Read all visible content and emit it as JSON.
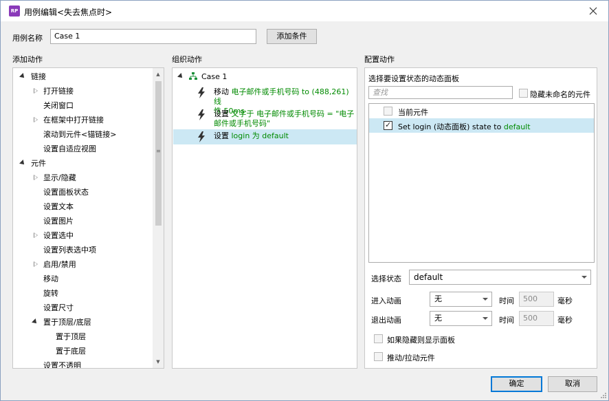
{
  "window": {
    "title": "用例编辑<失去焦点时>",
    "app_icon_text": "RP"
  },
  "case_name": {
    "label": "用例名称",
    "value": "Case 1",
    "add_condition_label": "添加条件"
  },
  "add_actions": {
    "heading": "添加动作",
    "items": [
      {
        "label": "链接",
        "level": 0,
        "state": "open"
      },
      {
        "label": "打开链接",
        "level": 1,
        "state": "closed"
      },
      {
        "label": "关闭窗口",
        "level": 1,
        "state": "none"
      },
      {
        "label": "在框架中打开链接",
        "level": 1,
        "state": "closed"
      },
      {
        "label": "滚动到元件<锚链接>",
        "level": 1,
        "state": "none"
      },
      {
        "label": "设置自适应视图",
        "level": 1,
        "state": "none"
      },
      {
        "label": "元件",
        "level": 0,
        "state": "open"
      },
      {
        "label": "显示/隐藏",
        "level": 1,
        "state": "closed"
      },
      {
        "label": "设置面板状态",
        "level": 1,
        "state": "none"
      },
      {
        "label": "设置文本",
        "level": 1,
        "state": "none"
      },
      {
        "label": "设置图片",
        "level": 1,
        "state": "none"
      },
      {
        "label": "设置选中",
        "level": 1,
        "state": "closed"
      },
      {
        "label": "设置列表选中项",
        "level": 1,
        "state": "none"
      },
      {
        "label": "启用/禁用",
        "level": 1,
        "state": "closed"
      },
      {
        "label": "移动",
        "level": 1,
        "state": "none"
      },
      {
        "label": "旋转",
        "level": 1,
        "state": "none"
      },
      {
        "label": "设置尺寸",
        "level": 1,
        "state": "none"
      },
      {
        "label": "置于顶层/底层",
        "level": 1,
        "state": "open"
      },
      {
        "label": "置于顶层",
        "level": 2,
        "state": "none"
      },
      {
        "label": "置于底层",
        "level": 2,
        "state": "none"
      },
      {
        "label": "设置不透明",
        "level": 1,
        "state": "none"
      }
    ]
  },
  "organize_actions": {
    "heading": "组织动作",
    "case_label": "Case 1",
    "actions": [
      {
        "verb": "移动",
        "line1": "电子邮件或手机号码 to (488,261) 线",
        "line2": "性 50ms"
      },
      {
        "verb": "设置",
        "line1": "文字于 电子邮件或手机号码 = \"电子",
        "line2": "邮件或手机号码\""
      },
      {
        "verb": "设置",
        "line1": "login 为 default",
        "line2": ""
      }
    ]
  },
  "config": {
    "heading": "配置动作",
    "panel_title": "选择要设置状态的动态面板",
    "search_placeholder": "查找",
    "hide_unnamed_label": "隐藏未命名的元件",
    "list": [
      {
        "label": "当前元件",
        "checked": false
      },
      {
        "prefix": "Set login (动态面板) state to ",
        "suffix": "default",
        "checked": true
      }
    ],
    "select_state_label": "选择状态",
    "select_state_value": "default",
    "enter_anim_label": "进入动画",
    "enter_anim_value": "无",
    "exit_anim_label": "退出动画",
    "exit_anim_value": "无",
    "time_label": "时间",
    "time_value": "500",
    "ms_label": "毫秒",
    "show_if_hidden_label": "如果隐藏则显示面板",
    "push_pull_label": "推动/拉动元件"
  },
  "footer": {
    "ok_label": "确定",
    "cancel_label": "取消"
  },
  "colors": {
    "action_green": "#008a00",
    "selection_blue": "#cce8f4",
    "icon_purple": "#8a3ab9"
  }
}
